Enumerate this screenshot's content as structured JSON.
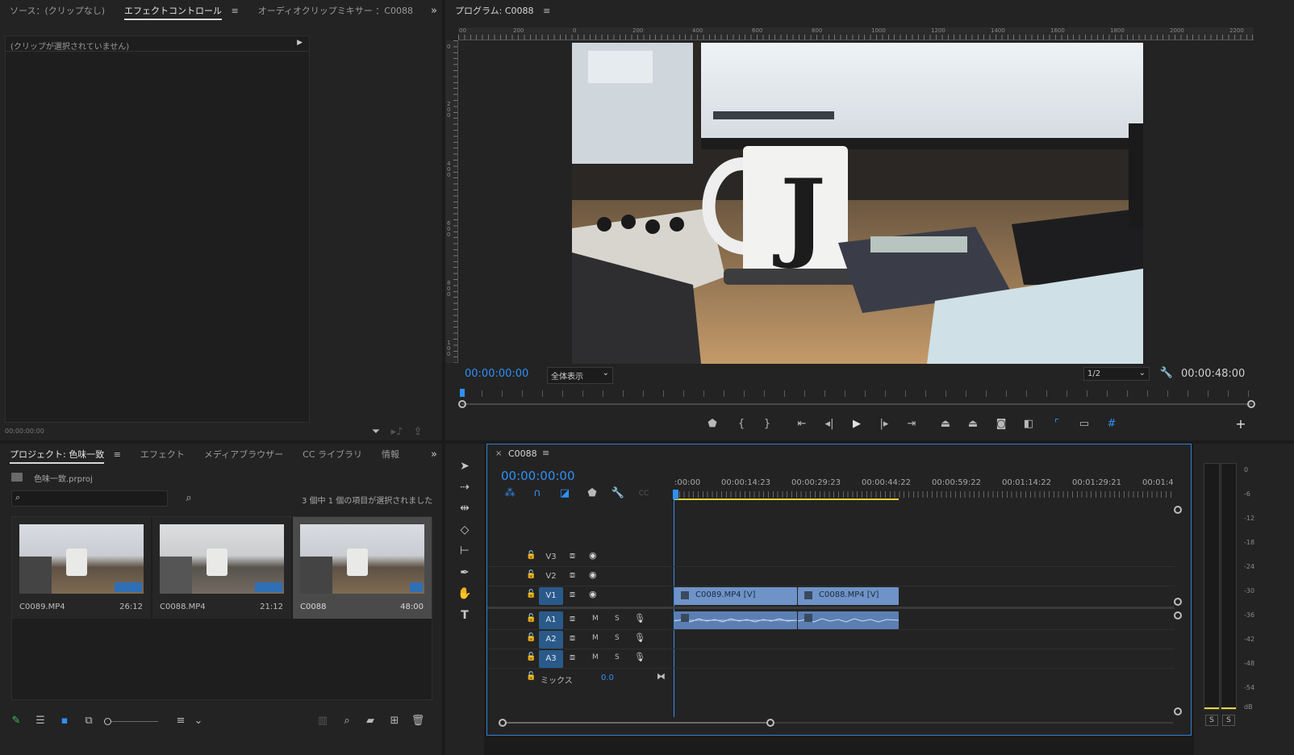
{
  "source_panel": {
    "tabs": [
      {
        "label": "ソース：(クリップなし)"
      },
      {
        "label": "エフェクトコントロール"
      },
      {
        "label": "オーディオクリップミキサー ：C0088"
      }
    ],
    "no_clip_message": "(クリップが選択されていません)",
    "timecode": "00:00:00:00"
  },
  "program_monitor": {
    "title": "プログラム: C0088",
    "ruler_h_labels": [
      "00",
      "200",
      "0",
      "200",
      "400",
      "600",
      "800",
      "1000",
      "1200",
      "1400",
      "1600",
      "1800",
      "2000",
      "2200"
    ],
    "ruler_v_labels": [
      "0",
      "200",
      "400",
      "600",
      "800",
      "100"
    ],
    "timecode_current": "00:00:00:00",
    "zoom": "全体表示",
    "resolution": "1/2",
    "timecode_duration": "00:00:48:00"
  },
  "project_panel": {
    "tabs": [
      {
        "label": "プロジェクト: 色味一致"
      },
      {
        "label": "エフェクト"
      },
      {
        "label": "メディアブラウザー"
      },
      {
        "label": "CC ライブラリ"
      },
      {
        "label": "情報"
      }
    ],
    "project_file": "色味一致.prproj",
    "search_placeholder": "",
    "selection_status": "3 個中 1 個の項目が選択されました",
    "items": [
      {
        "name": "C0089.MP4",
        "duration": "26:12"
      },
      {
        "name": "C0088.MP4",
        "duration": "21:12"
      },
      {
        "name": "C0088",
        "duration": "48:00"
      }
    ]
  },
  "timeline": {
    "sequence_name": "C0088",
    "timecode": "00:00:00:00",
    "ruler_labels": [
      ":00:00",
      "00:00:14:23",
      "00:00:29:23",
      "00:00:44:22",
      "00:00:59:22",
      "00:01:14:22",
      "00:01:29:21",
      "00:01:4"
    ],
    "video_tracks": [
      {
        "label": "V3"
      },
      {
        "label": "V2"
      },
      {
        "label": "V1"
      }
    ],
    "audio_tracks": [
      {
        "label": "A1",
        "m": "M",
        "s": "S"
      },
      {
        "label": "A2",
        "m": "M",
        "s": "S"
      },
      {
        "label": "A3",
        "m": "M",
        "s": "S"
      }
    ],
    "mix_label": "ミックス",
    "mix_value": "0.0",
    "clips": [
      {
        "name": "C0089.MP4 [V]"
      },
      {
        "name": "C0088.MP4 [V]"
      }
    ]
  },
  "audio_meter": {
    "labels": [
      "0",
      "-6",
      "-12",
      "-18",
      "-24",
      "-30",
      "-36",
      "-42",
      "-48",
      "-54",
      "dB"
    ],
    "solo_left": "S",
    "solo_right": "S"
  }
}
